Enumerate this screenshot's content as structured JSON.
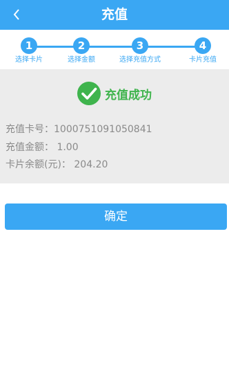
{
  "header": {
    "title": "充值",
    "back_icon": "chevron-left-icon"
  },
  "steps": [
    {
      "number": "1",
      "label": "选择卡片"
    },
    {
      "number": "2",
      "label": "选择金额"
    },
    {
      "number": "3",
      "label": "选择充值方式"
    },
    {
      "number": "4",
      "label": "卡片充值"
    }
  ],
  "result": {
    "icon": "check-circle-icon",
    "status_text": "充值成功",
    "card_number_label": "充值卡号：",
    "card_number": "1000751091050841",
    "amount_label": "充值金额：",
    "amount": "1.00",
    "balance_label": "卡片余额(元)：",
    "balance": "204.20"
  },
  "confirm": {
    "label": "确定"
  },
  "colors": {
    "accent": "#3aa7f3",
    "success": "#3fb44d",
    "panel_bg": "#ececec",
    "text_muted": "#8a8a8a"
  }
}
